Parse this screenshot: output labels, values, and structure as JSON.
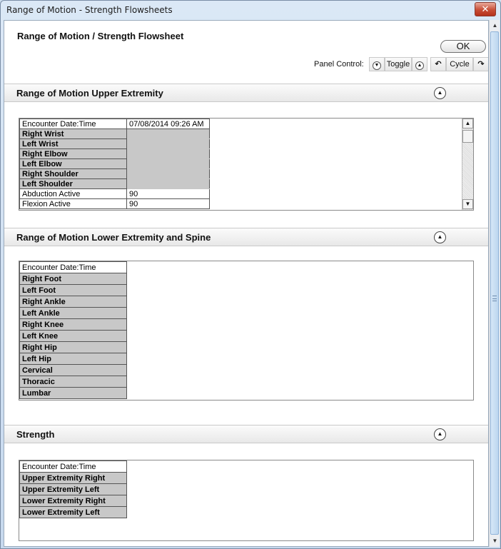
{
  "window": {
    "title": "Range of Motion - Strength Flowsheets",
    "close_label": "✕"
  },
  "header": {
    "page_title": "Range of Motion / Strength Flowsheet",
    "ok_label": "OK",
    "panel_control_label": "Panel Control:",
    "toggle_label": "Toggle",
    "cycle_label": "Cycle"
  },
  "sections": {
    "upper": {
      "title": "Range of Motion Upper Extremity",
      "rows": [
        {
          "label": "Encounter Date:Time",
          "value": "07/08/2014 09:26 AM"
        },
        {
          "label": "Right Wrist",
          "value": ""
        },
        {
          "label": "Left Wrist",
          "value": ""
        },
        {
          "label": "Right Elbow",
          "value": ""
        },
        {
          "label": "Left Elbow",
          "value": ""
        },
        {
          "label": "Right Shoulder",
          "value": ""
        },
        {
          "label": "Left Shoulder",
          "value": ""
        },
        {
          "label": "Abduction Active",
          "value": "90"
        },
        {
          "label": "Flexion Active",
          "value": "90"
        }
      ]
    },
    "lower": {
      "title": "Range of Motion Lower Extremity and Spine",
      "rows": [
        {
          "label": "Encounter Date:Time"
        },
        {
          "label": "Right Foot"
        },
        {
          "label": "Left Foot"
        },
        {
          "label": "Right Ankle"
        },
        {
          "label": "Left Ankle"
        },
        {
          "label": "Right Knee"
        },
        {
          "label": "Left Knee"
        },
        {
          "label": "Right Hip"
        },
        {
          "label": "Left Hip"
        },
        {
          "label": "Cervical"
        },
        {
          "label": "Thoracic"
        },
        {
          "label": "Lumbar"
        }
      ]
    },
    "strength": {
      "title": "Strength",
      "rows": [
        {
          "label": "Encounter Date:Time"
        },
        {
          "label": "Upper Extremity Right"
        },
        {
          "label": "Upper Extremity Left"
        },
        {
          "label": "Lower Extremity Right"
        },
        {
          "label": "Lower Extremity Left"
        }
      ]
    }
  }
}
